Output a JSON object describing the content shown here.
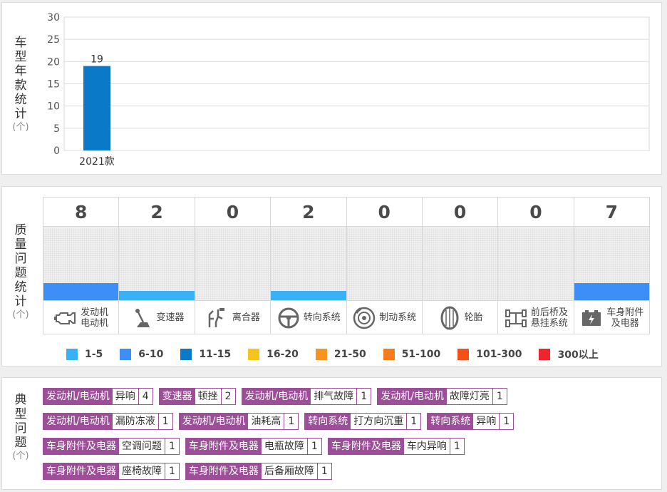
{
  "year_panel": {
    "label_chars": [
      "车",
      "型",
      "年",
      "款",
      "统",
      "计"
    ],
    "unit": "(个)",
    "chart_data": {
      "type": "bar",
      "categories": [
        "2021款"
      ],
      "values": [
        19
      ],
      "data_labels": [
        "19"
      ],
      "ylim": [
        0,
        30
      ],
      "yticks": [
        0,
        5,
        10,
        15,
        20,
        25,
        30
      ],
      "grid": true,
      "bar_color": "#0a79c8"
    }
  },
  "quality_panel": {
    "label_chars": [
      "质",
      "量",
      "问",
      "题",
      "统",
      "计"
    ],
    "unit": "(个)",
    "columns": [
      {
        "count": "8",
        "label_lines": [
          "发动机",
          "电动机"
        ],
        "icon": "engine-icon",
        "fill": 0.24,
        "color": "#3e8ef7"
      },
      {
        "count": "2",
        "label_lines": [
          "变速器"
        ],
        "icon": "gear-shift-icon",
        "fill": 0.13,
        "color": "#38b2f5"
      },
      {
        "count": "0",
        "label_lines": [
          "离合器"
        ],
        "icon": "clutch-icon",
        "fill": 0,
        "color": "#38b2f5"
      },
      {
        "count": "2",
        "label_lines": [
          "转向系统"
        ],
        "icon": "steering-wheel-icon",
        "fill": 0.13,
        "color": "#38b2f5"
      },
      {
        "count": "0",
        "label_lines": [
          "制动系统"
        ],
        "icon": "brake-disc-icon",
        "fill": 0,
        "color": "#38b2f5"
      },
      {
        "count": "0",
        "label_lines": [
          "轮胎"
        ],
        "icon": "tire-icon",
        "fill": 0,
        "color": "#38b2f5"
      },
      {
        "count": "0",
        "label_lines": [
          "前后桥及",
          "悬挂系统"
        ],
        "icon": "axle-suspension-icon",
        "fill": 0,
        "color": "#38b2f5"
      },
      {
        "count": "7",
        "label_lines": [
          "车身附件",
          "及电器"
        ],
        "icon": "battery-icon",
        "fill": 0.24,
        "color": "#3e8ef7"
      }
    ],
    "legend": [
      {
        "label": "1-5",
        "color": "#38b2f5"
      },
      {
        "label": "6-10",
        "color": "#3e8ef7"
      },
      {
        "label": "11-15",
        "color": "#0a79c8"
      },
      {
        "label": "16-20",
        "color": "#f6c51b"
      },
      {
        "label": "21-50",
        "color": "#f7931e"
      },
      {
        "label": "51-100",
        "color": "#f77a1d"
      },
      {
        "label": "101-300",
        "color": "#f5501a"
      },
      {
        "label": "300以上",
        "color": "#f0242c"
      }
    ]
  },
  "issues_panel": {
    "label_chars": [
      "典",
      "型",
      "问",
      "题"
    ],
    "unit": "(个)",
    "rows": [
      [
        {
          "category": "发动机/电动机",
          "issue": "异响",
          "count": "4"
        },
        {
          "category": "变速器",
          "issue": "顿挫",
          "count": "2"
        },
        {
          "category": "发动机/电动机",
          "issue": "排气故障",
          "count": "1"
        },
        {
          "category": "发动机/电动机",
          "issue": "故障灯亮",
          "count": "1"
        }
      ],
      [
        {
          "category": "发动机/电动机",
          "issue": "漏防冻液",
          "count": "1"
        },
        {
          "category": "发动机/电动机",
          "issue": "油耗高",
          "count": "1"
        },
        {
          "category": "转向系统",
          "issue": "打方向沉重",
          "count": "1"
        },
        {
          "category": "转向系统",
          "issue": "异响",
          "count": "1"
        }
      ],
      [
        {
          "category": "车身附件及电器",
          "issue": "空调问题",
          "count": "1"
        },
        {
          "category": "车身附件及电器",
          "issue": "电瓶故障",
          "count": "1"
        },
        {
          "category": "车身附件及电器",
          "issue": "车内异响",
          "count": "1"
        }
      ],
      [
        {
          "category": "车身附件及电器",
          "issue": "座椅故障",
          "count": "1"
        },
        {
          "category": "车身附件及电器",
          "issue": "后备厢故障",
          "count": "1"
        }
      ]
    ]
  }
}
